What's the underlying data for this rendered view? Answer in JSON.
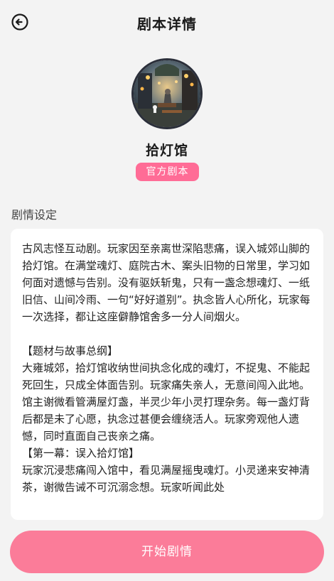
{
  "header": {
    "title": "剧本详情"
  },
  "script": {
    "name": "拾灯馆",
    "badge": "官方剧本"
  },
  "section": {
    "label": "剧情设定"
  },
  "story": {
    "intro": "古风志怪互动剧。玩家因至亲离世深陷悲痛，误入城郊山脚的拾灯馆。在满堂魂灯、庭院古木、案头旧物的日常里，学习如何面对遗憾与告别。没有驱妖斩鬼，只有一盏念想魂灯、一纸旧信、山间冷雨、一句“好好道别”。执念皆人心所化，玩家每一次选择，都让这座僻静馆舍多一分人间烟火。",
    "outline_heading": "【题材与故事总纲】",
    "outline_body": "大雍城郊，拾灯馆收纳世间执念化成的魂灯，不捉鬼、不能起死回生，只成全体面告别。玩家痛失亲人，无意间闯入此地。馆主谢微看管满屋灯盏，半灵少年小灵打理杂务。每一盏灯背后都是未了心愿，执念过甚便会缠绕活人。玩家旁观他人遗憾，同时直面自己丧亲之痛。",
    "act1_heading": "【第一幕：误入拾灯馆】",
    "act1_body": "玩家沉浸悲痛闯入馆中，看见满屋摇曳魂灯。小灵递来安神清茶，谢微告诫不可沉溺念想。玩家听闻此处"
  },
  "actions": {
    "start_label": "开始剧情"
  }
}
